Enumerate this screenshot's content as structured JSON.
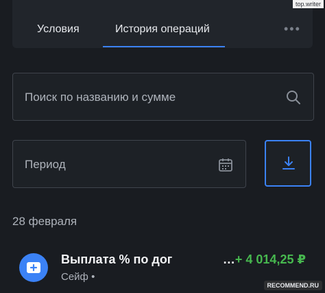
{
  "tabs": [
    {
      "label": "Условия",
      "active": false
    },
    {
      "label": "История операций",
      "active": true
    }
  ],
  "more_icon": "more-horizontal-icon",
  "search": {
    "placeholder": "Поиск по названию и сумме",
    "icon": "search-icon"
  },
  "period": {
    "placeholder": "Период",
    "icon": "calendar-icon"
  },
  "download": {
    "icon": "download-icon"
  },
  "date_header": "28 февраля",
  "operation": {
    "title": "Выплата % по дог",
    "subtitle": "Сейф •",
    "amount_prefix": "…",
    "amount": "+ 4 014,25 ₽",
    "icon": "safe-plus-icon"
  },
  "watermarks": {
    "top": "top.writer",
    "bottom": "RECOMMEND.RU"
  },
  "colors": {
    "accent": "#3b82f6",
    "positive": "#47b84f",
    "background": "#191c21"
  }
}
